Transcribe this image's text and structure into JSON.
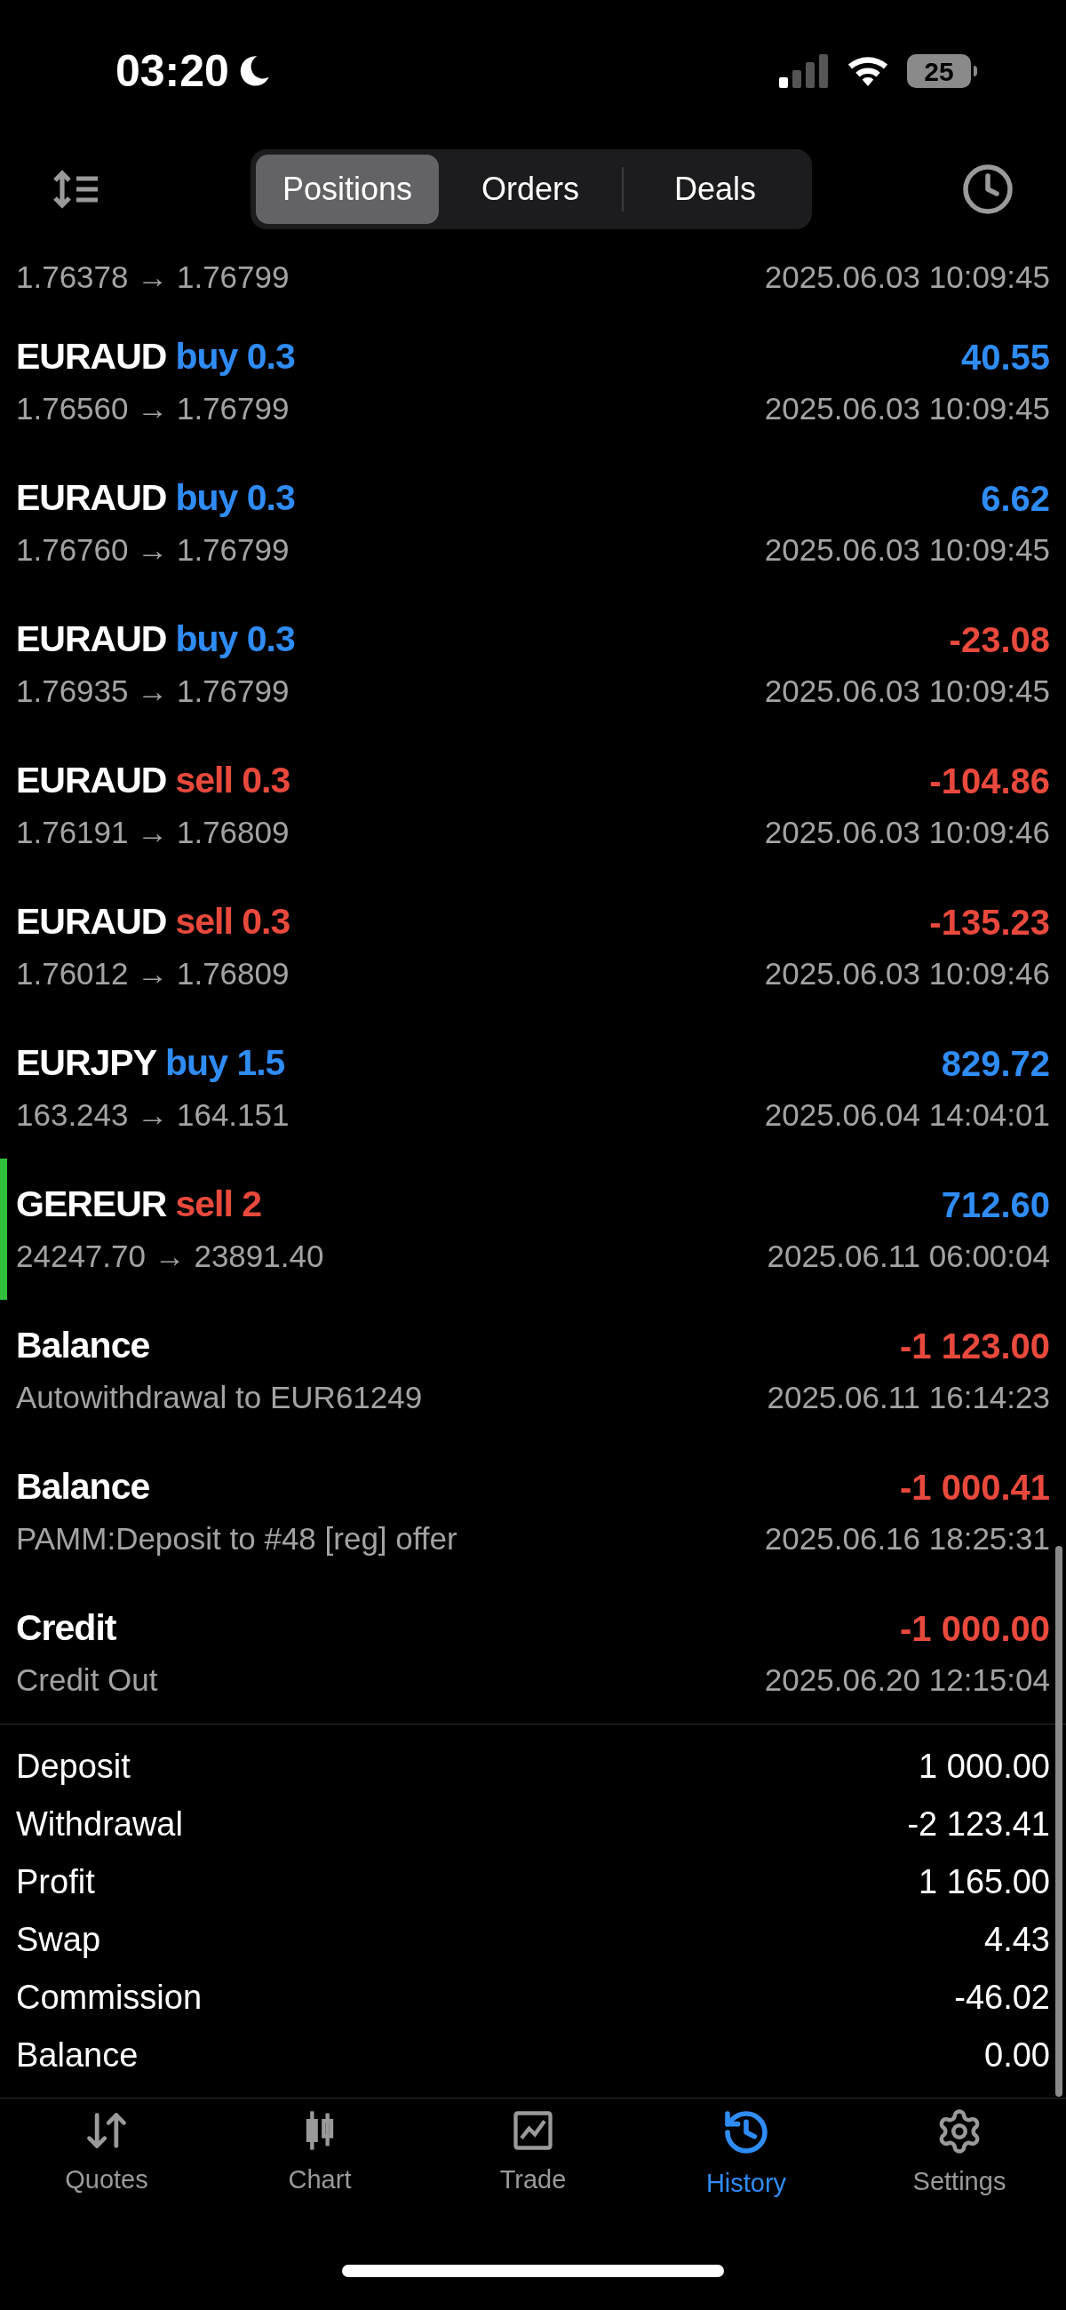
{
  "status_bar": {
    "time": "03:20",
    "battery": "25"
  },
  "tabs": [
    {
      "label": "Positions",
      "selected": true
    },
    {
      "label": "Orders",
      "selected": false
    },
    {
      "label": "Deals",
      "selected": false
    }
  ],
  "partial_row": {
    "subtitle": "1.76378 → 1.76799",
    "time": "2025.06.03 10:09:45"
  },
  "rows": [
    {
      "kind": "trade",
      "symbol": "EURAUD",
      "side": "buy",
      "volume": "0.3",
      "amount": "40.55",
      "color": "#2f8cf5",
      "subtitle": "1.76560 → 1.76799",
      "time": "2025.06.03 10:09:45",
      "highlighted": false
    },
    {
      "kind": "trade",
      "symbol": "EURAUD",
      "side": "buy",
      "volume": "0.3",
      "amount": "6.62",
      "color": "#2f8cf5",
      "subtitle": "1.76760 → 1.76799",
      "time": "2025.06.03 10:09:45",
      "highlighted": false
    },
    {
      "kind": "trade",
      "symbol": "EURAUD",
      "side": "buy",
      "volume": "0.3",
      "amount": "-23.08",
      "color": "#e8493c",
      "subtitle": "1.76935 → 1.76799",
      "time": "2025.06.03 10:09:45",
      "highlighted": false
    },
    {
      "kind": "trade",
      "symbol": "EURAUD",
      "side": "sell",
      "volume": "0.3",
      "amount": "-104.86",
      "color": "#e8493c",
      "subtitle": "1.76191 → 1.76809",
      "time": "2025.06.03 10:09:46",
      "highlighted": false
    },
    {
      "kind": "trade",
      "symbol": "EURAUD",
      "side": "sell",
      "volume": "0.3",
      "amount": "-135.23",
      "color": "#e8493c",
      "subtitle": "1.76012 → 1.76809",
      "time": "2025.06.03 10:09:46",
      "highlighted": false
    },
    {
      "kind": "trade",
      "symbol": "EURJPY",
      "side": "buy",
      "volume": "1.5",
      "amount": "829.72",
      "color": "#2f8cf5",
      "subtitle": "163.243 → 164.151",
      "time": "2025.06.04 14:04:01",
      "highlighted": false
    },
    {
      "kind": "trade",
      "symbol": "GEREUR",
      "side": "sell",
      "volume": "2",
      "amount": "712.60",
      "color": "#2f8cf5",
      "subtitle": "24247.70 → 23891.40",
      "time": "2025.06.11 06:00:04",
      "highlighted": true
    },
    {
      "kind": "operation",
      "symbol": "Balance",
      "amount": "-1 123.00",
      "color": "#e8493c",
      "subtitle": "Autowithdrawal to EUR61249",
      "time": "2025.06.11 16:14:23",
      "highlighted": false
    },
    {
      "kind": "operation",
      "symbol": "Balance",
      "amount": "-1 000.41",
      "color": "#e8493c",
      "subtitle": "PAMM:Deposit to #48 [reg] offer",
      "time": "2025.06.16 18:25:31",
      "highlighted": false
    },
    {
      "kind": "operation",
      "symbol": "Credit",
      "amount": "-1 000.00",
      "color": "#e8493c",
      "subtitle": "Credit Out",
      "time": "2025.06.20 12:15:04",
      "highlighted": false
    }
  ],
  "summary": [
    {
      "label": "Deposit",
      "value": "1 000.00"
    },
    {
      "label": "Withdrawal",
      "value": "-2 123.41"
    },
    {
      "label": "Profit",
      "value": "1 165.00"
    },
    {
      "label": "Swap",
      "value": "4.43"
    },
    {
      "label": "Commission",
      "value": "-46.02"
    },
    {
      "label": "Balance",
      "value": "0.00"
    }
  ],
  "nav": [
    {
      "kind": "quotes",
      "label": "Quotes",
      "selected": false
    },
    {
      "kind": "chart",
      "label": "Chart",
      "selected": false
    },
    {
      "kind": "trade",
      "label": "Trade",
      "selected": false
    },
    {
      "kind": "history",
      "label": "History",
      "selected": true
    },
    {
      "kind": "settings",
      "label": "Settings",
      "selected": false
    }
  ]
}
